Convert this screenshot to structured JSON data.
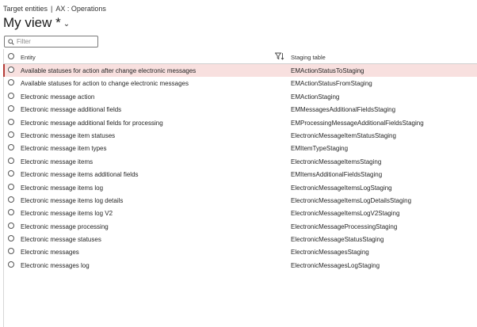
{
  "breadcrumb": {
    "target": "Target entities",
    "separator": "|",
    "context": "AX : Operations"
  },
  "view": {
    "title": "My view *",
    "chevron_icon": "chevron-down-icon"
  },
  "filter": {
    "placeholder": "Filter",
    "value": "",
    "icon": "search-icon"
  },
  "table": {
    "columns": {
      "entity": "Entity",
      "staging": "Staging table",
      "filter_icon": "column-filter-icon"
    },
    "rows": [
      {
        "entity": "Available statuses for action after change electronic messages",
        "staging": "EMActionStatusToStaging",
        "selected": true
      },
      {
        "entity": "Available statuses for action to change electronic messages",
        "staging": "EMActionStatusFromStaging"
      },
      {
        "entity": "Electronic message action",
        "staging": "EMActionStaging"
      },
      {
        "entity": "Electronic message additional fields",
        "staging": "EMMessagesAdditionalFieldsStaging"
      },
      {
        "entity": "Electronic message additional fields for processing",
        "staging": "EMProcessingMessageAdditionalFieldsStaging"
      },
      {
        "entity": "Electronic message item statuses",
        "staging": "ElectronicMessageItemStatusStaging"
      },
      {
        "entity": "Electronic message item types",
        "staging": "EMItemTypeStaging"
      },
      {
        "entity": "Electronic message items",
        "staging": "ElectronicMessageItemsStaging"
      },
      {
        "entity": "Electronic message items additional fields",
        "staging": "EMItemsAdditionalFieldsStaging"
      },
      {
        "entity": "Electronic message items log",
        "staging": "ElectronicMessageItemsLogStaging"
      },
      {
        "entity": "Electronic message items log details",
        "staging": "ElectronicMessageItemsLogDetailsStaging"
      },
      {
        "entity": "Electronic message items log V2",
        "staging": "ElectronicMessageItemsLogV2Staging"
      },
      {
        "entity": "Electronic message processing",
        "staging": "ElectronicMessageProcessingStaging"
      },
      {
        "entity": "Electronic message statuses",
        "staging": "ElectronicMessageStatusStaging"
      },
      {
        "entity": "Electronic messages",
        "staging": "ElectronicMessagesStaging"
      },
      {
        "entity": "Electronic messages log",
        "staging": "ElectronicMessagesLogStaging"
      }
    ]
  }
}
